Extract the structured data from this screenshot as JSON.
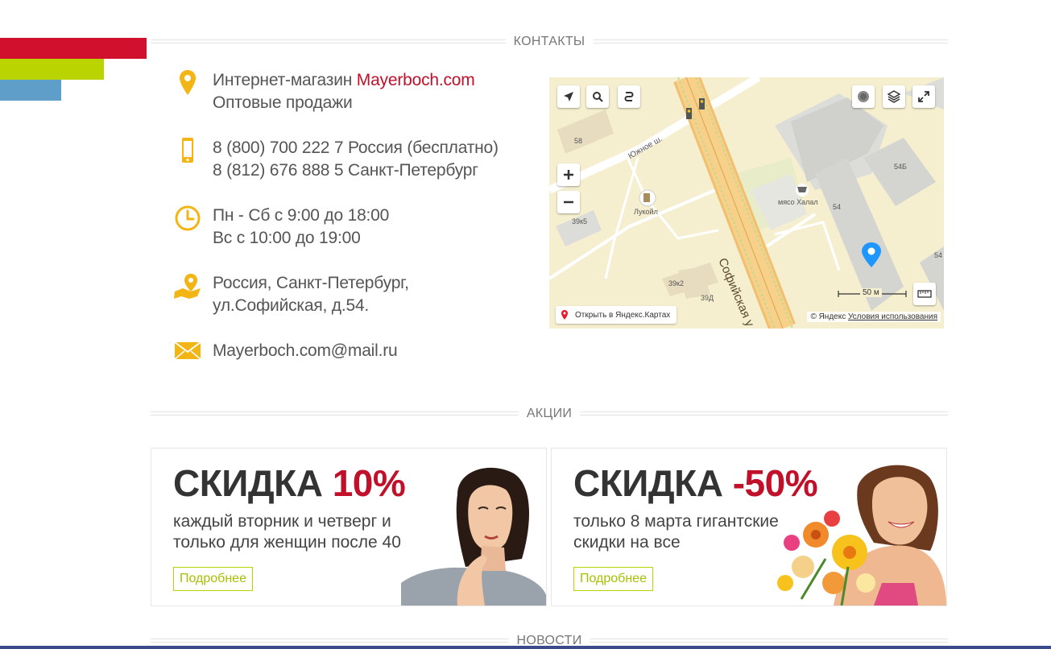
{
  "sections": {
    "contacts_title": "КОНТАКТЫ",
    "promo_title": "АКЦИИ",
    "news_title": "НОВОСТИ"
  },
  "contacts": {
    "shop_prefix": "Интернет-магазин ",
    "shop_brand": "Mayerboch.com",
    "wholesale": "Оптовые продажи",
    "phone_1": "8 (800) 700 222 7 Россия (бесплатно)",
    "phone_2": "8 (812) 676 888 5 Санкт-Петербург",
    "hours_1": "Пн - Сб с 9:00 до 18:00",
    "hours_2": "Вс с 10:00 до 19:00",
    "address_1": "Россия, Санкт-Петербург,",
    "address_2": "ул.Софийская, д.54.",
    "email": "Mayerboch.com@mail.ru"
  },
  "map": {
    "open_link": "Открыть в Яндекс.Картах",
    "copyright": "© Яндекс",
    "terms": "Условия использования",
    "scale": "50 м",
    "labels": {
      "street_south": "Южное ш.",
      "street_sofia": "Софийская у",
      "lukoil": "Лукойл",
      "meat": "мясо Халал",
      "b58": "58",
      "b54b": "54Б",
      "b54": "54",
      "b54r": "54",
      "b39k5": "39к5",
      "b39k2": "39к2",
      "b39d": "39Д"
    }
  },
  "promos": [
    {
      "title": "СКИДКА ",
      "percent": "10%",
      "description": "каждый вторник и четверг и только для женщин после 40",
      "button": "Подробнее"
    },
    {
      "title": "СКИДКА ",
      "percent": "-50%",
      "description": "только 8 марта гигантские скидки на все",
      "button": "Подробнее"
    }
  ],
  "colors": {
    "accent_red": "#c0102a",
    "accent_green": "#b9d400",
    "accent_blue": "#5f9ec8",
    "icon_yellow": "#f3b514"
  }
}
